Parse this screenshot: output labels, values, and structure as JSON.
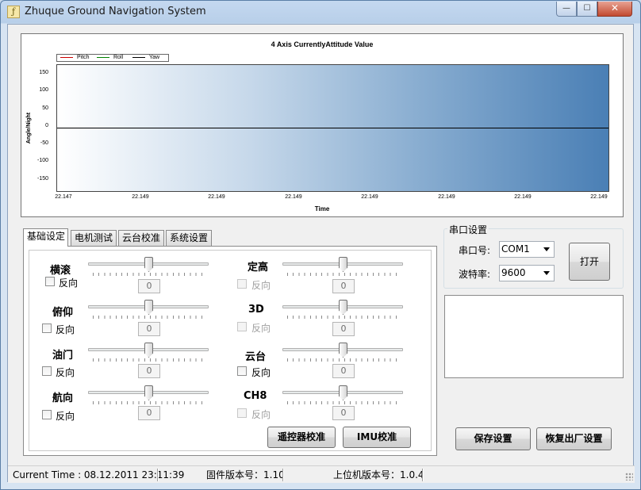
{
  "window": {
    "title": "Zhuque Ground Navigation System",
    "icon": "app-logo-icon",
    "controls": {
      "minimize": "—",
      "maximize": "☐",
      "close": "✕"
    }
  },
  "chart": {
    "title": "4 Axis CurrentlyAttitude Value",
    "xlabel": "Time",
    "ylabel": "Angle/Night",
    "legend": [
      "Pitch",
      "Roll",
      "Yaw"
    ],
    "yticks": [
      "150",
      "100",
      "50",
      "0",
      "-50",
      "-100",
      "-150"
    ],
    "xticks": [
      "22.147",
      "22.149",
      "22.149",
      "22.149",
      "22.149",
      "22.149",
      "22.149",
      "22.149"
    ]
  },
  "chart_data": {
    "type": "line",
    "title": "4 Axis CurrentlyAttitude Value",
    "xlabel": "Time",
    "ylabel": "Angle/Night",
    "ylim": [
      -180,
      180
    ],
    "x_ticks": [
      "22.147",
      "22.149",
      "22.149",
      "22.149",
      "22.149",
      "22.149",
      "22.149",
      "22.149"
    ],
    "y_ticks": [
      150,
      100,
      50,
      0,
      -50,
      -100,
      -150
    ],
    "legend_position": "top-left",
    "grid": false,
    "series": [
      {
        "name": "Pitch",
        "color": "#cc0000",
        "values": [
          0,
          0
        ]
      },
      {
        "name": "Roll",
        "color": "#008000",
        "values": [
          0,
          0
        ]
      },
      {
        "name": "Yaw",
        "color": "#000000",
        "values": [
          0,
          0
        ]
      }
    ]
  },
  "tabs": [
    {
      "label": "基础设定",
      "active": true
    },
    {
      "label": "电机测试",
      "active": false
    },
    {
      "label": "云台校准",
      "active": false
    },
    {
      "label": "系统设置",
      "active": false
    }
  ],
  "controls_left": [
    {
      "label": "横滚",
      "checkbox": "反向",
      "value": "0"
    },
    {
      "label": "俯仰",
      "checkbox": "反向",
      "value": "0"
    },
    {
      "label": "油门",
      "checkbox": "反向",
      "value": "0"
    },
    {
      "label": "航向",
      "checkbox": "反向",
      "value": "0"
    }
  ],
  "controls_right": [
    {
      "label": "定高",
      "checkbox": "反向",
      "value": "0",
      "enabled": false
    },
    {
      "label": "3D",
      "checkbox": "反向",
      "value": "0",
      "enabled": false
    },
    {
      "label": "云台",
      "checkbox": "反向",
      "value": "0",
      "enabled": true
    },
    {
      "label": "CH8",
      "checkbox": "反向",
      "value": "0",
      "enabled": false
    }
  ],
  "buttons": {
    "remote_calibrate": "遥控器校准",
    "imu_calibrate": "IMU校准",
    "open": "打开",
    "save_settings": "保存设置",
    "factory_reset": "恢复出厂设置"
  },
  "serial": {
    "group_title": "串口设置",
    "port_label": "串口号:",
    "port_value": "COM1",
    "baud_label": "波特率:",
    "baud_value": "9600"
  },
  "status": {
    "current_time": "Current Time : 08.12.2011 23:11:39",
    "firmware": "固件版本号：1.10",
    "host": "上位机版本号：1.0.4"
  }
}
